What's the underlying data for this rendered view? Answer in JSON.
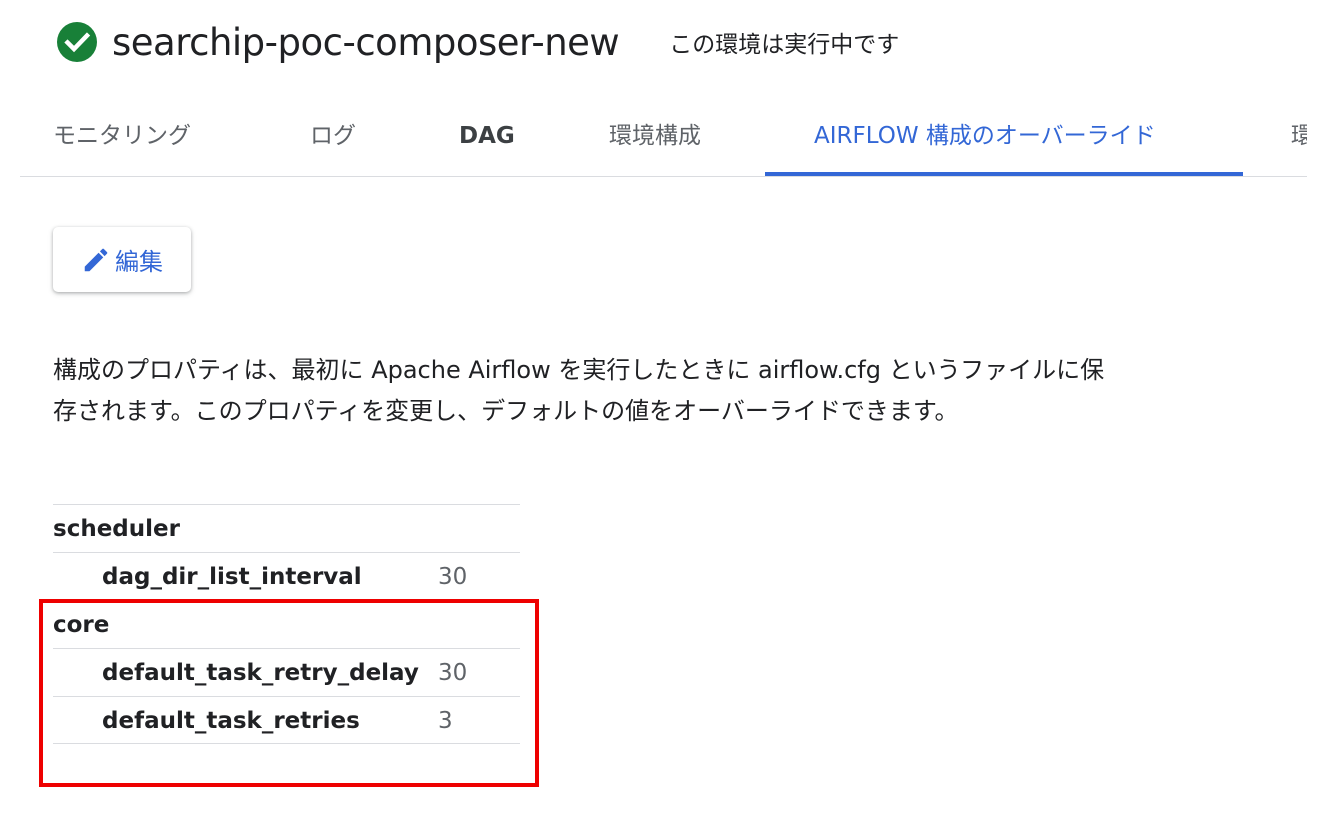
{
  "header": {
    "status_icon": "check-circle-icon",
    "status_color": "#188038",
    "environment_name": "searchip-poc-composer-new",
    "status_text": "この環境は実行中です"
  },
  "tabs": [
    {
      "label": "モニタリング"
    },
    {
      "label": "ログ"
    },
    {
      "label": "DAG"
    },
    {
      "label": "環境構成"
    },
    {
      "label": "AIRFLOW 構成のオーバーライド",
      "active": true
    },
    {
      "label": "環"
    }
  ],
  "accent_color": "#3367d6",
  "toolbar": {
    "edit_icon": "pencil-icon",
    "edit_label": "編集"
  },
  "description": "構成のプロパティは、最初に Apache Airflow を実行したときに airflow.cfg というファイルに保存されます。このプロパティを変更し、デフォルトの値をオーバーライドできます。",
  "overrides": {
    "sections": [
      {
        "name": "scheduler",
        "properties": [
          {
            "key": "dag_dir_list_interval",
            "value": "30"
          }
        ]
      },
      {
        "name": "core",
        "properties": [
          {
            "key": "default_task_retry_delay",
            "value": "30"
          },
          {
            "key": "default_task_retries",
            "value": "3"
          }
        ]
      }
    ]
  },
  "highlight_color": "#ee0000"
}
